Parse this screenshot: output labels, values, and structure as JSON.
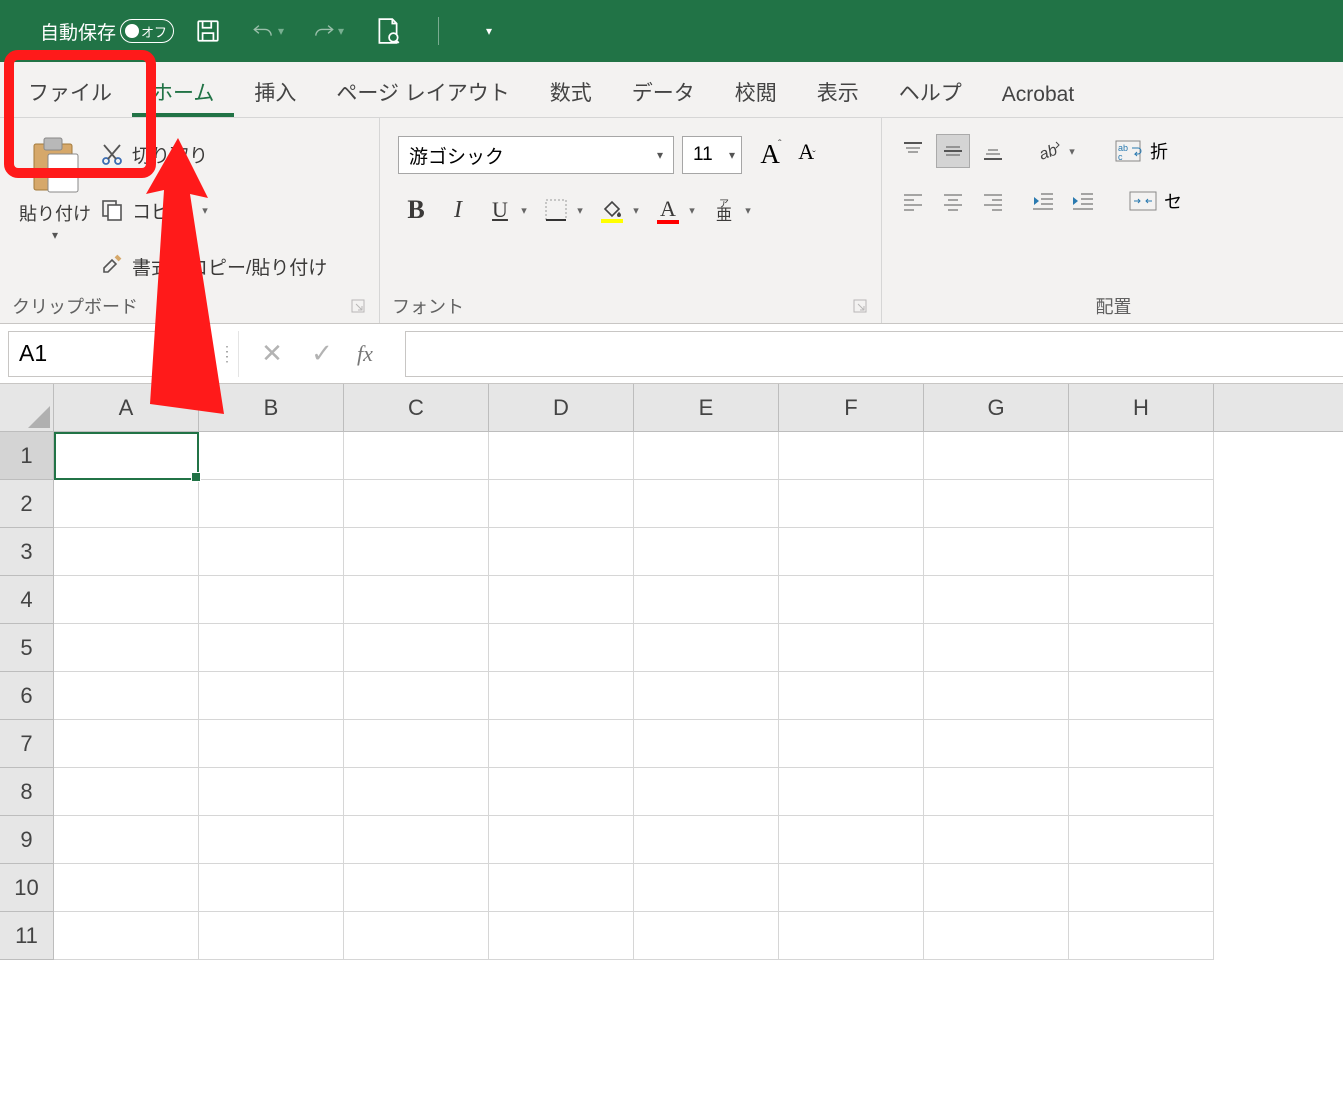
{
  "titlebar": {
    "autosave_label": "自動保存",
    "autosave_state": "オフ",
    "qat": {
      "save": "save-icon",
      "undo": "undo-icon",
      "redo": "redo-icon",
      "print": "print-icon",
      "more": "more-icon"
    }
  },
  "tabs": [
    {
      "id": "file",
      "label": "ファイル",
      "active": false
    },
    {
      "id": "home",
      "label": "ホーム",
      "active": true
    },
    {
      "id": "insert",
      "label": "挿入",
      "active": false
    },
    {
      "id": "pagelayout",
      "label": "ページ レイアウト",
      "active": false
    },
    {
      "id": "formulas",
      "label": "数式",
      "active": false
    },
    {
      "id": "data",
      "label": "データ",
      "active": false
    },
    {
      "id": "review",
      "label": "校閲",
      "active": false
    },
    {
      "id": "view",
      "label": "表示",
      "active": false
    },
    {
      "id": "help",
      "label": "ヘルプ",
      "active": false
    },
    {
      "id": "acrobat",
      "label": "Acrobat",
      "active": false
    }
  ],
  "ribbon": {
    "clipboard": {
      "paste_label": "貼り付け",
      "cut_label": "切り取り",
      "copy_label": "コピー",
      "format_painter_label": "書式のコピー/貼り付け",
      "group_label": "クリップボード"
    },
    "font": {
      "name": "游ゴシック",
      "size": "11",
      "bold": "B",
      "italic": "I",
      "underline": "U",
      "phonetic": "ア亜",
      "group_label": "フォント"
    },
    "alignment": {
      "group_label": "配置",
      "wrap_hint": "abc",
      "merge_hint": "セ"
    }
  },
  "formula_bar": {
    "name_box": "A1",
    "fx": "fx",
    "formula": ""
  },
  "grid": {
    "columns": [
      "A",
      "B",
      "C",
      "D",
      "E",
      "F",
      "G",
      "H"
    ],
    "rows": [
      "1",
      "2",
      "3",
      "4",
      "5",
      "6",
      "7",
      "8",
      "9",
      "10",
      "11"
    ],
    "selected": "A1"
  },
  "annotation": {
    "highlighted_tab": "file"
  }
}
